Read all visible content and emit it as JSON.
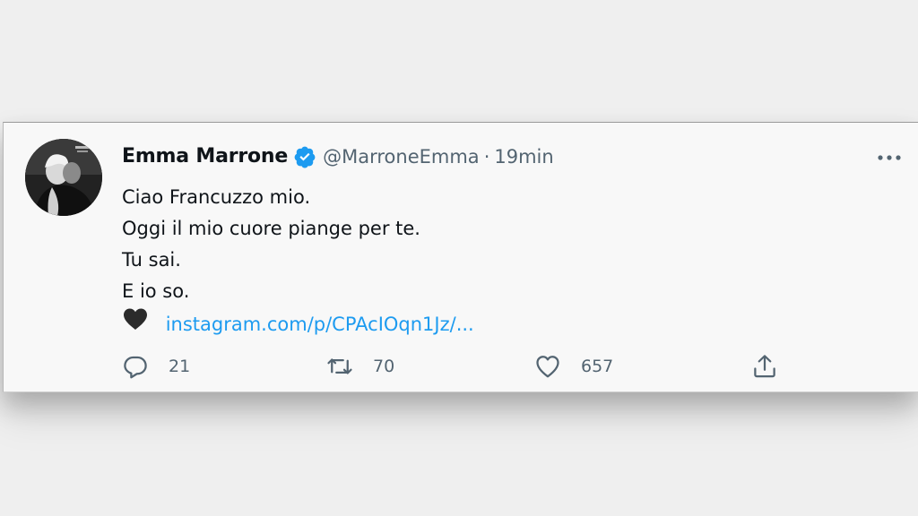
{
  "tweet": {
    "author": {
      "display_name": "Emma Marrone",
      "handle": "@MarroneEmma",
      "verified_icon": "verified-badge-icon",
      "avatar": "profile-photo"
    },
    "separator": "·",
    "timestamp": "19min",
    "menu_icon": "more-horizontal-icon",
    "lines": [
      "Ciao Francuzzo mio.",
      "Oggi il mio cuore piange per te.",
      "Tu sai.",
      "E io so."
    ],
    "emoji": "black-heart-emoji",
    "link_text": "instagram.com/p/CPAcIOqn1Jz/...",
    "actions": {
      "reply": {
        "icon": "reply-icon",
        "count": "21"
      },
      "retweet": {
        "icon": "retweet-icon",
        "count": "70"
      },
      "like": {
        "icon": "like-heart-icon",
        "count": "657"
      },
      "share": {
        "icon": "share-icon"
      }
    },
    "colors": {
      "link": "#1d9bf0",
      "verified": "#1d9bf0",
      "secondary_text": "#536471",
      "primary_text": "#0f1419"
    }
  }
}
